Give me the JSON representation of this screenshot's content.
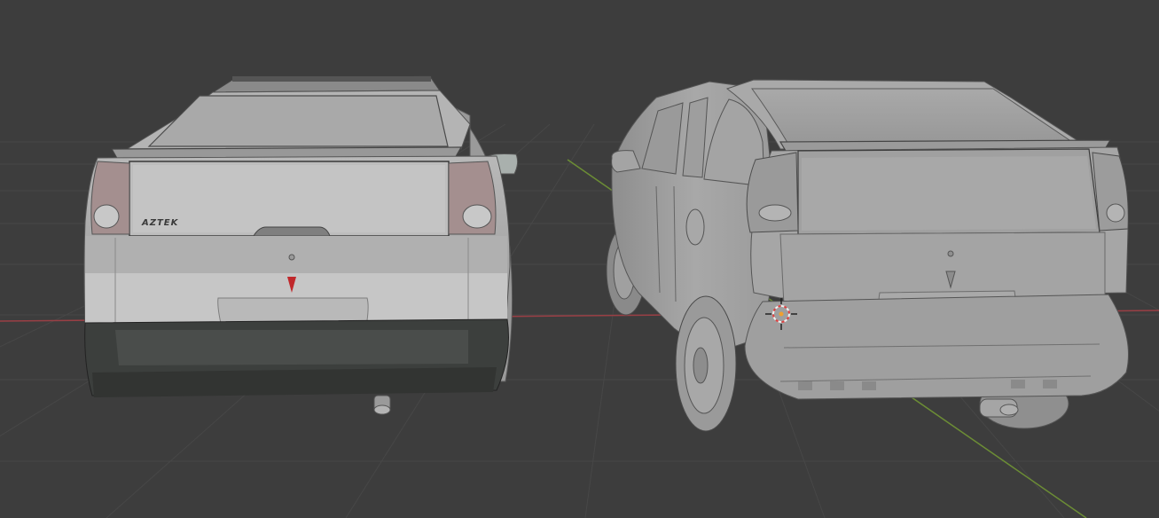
{
  "viewport": {
    "background": "#3d3d3d",
    "grid_color": "#474747",
    "x_axis_color": "#9a3f45",
    "y_axis_color": "#6c8d35"
  },
  "left_model": {
    "badge_text": "AZTEK",
    "body_color": "#a7a7a7",
    "lower_color": "#3c3f3d",
    "taillight_color": "#a48f8f",
    "emblem_color": "#c0282b"
  },
  "right_model": {
    "body_color": "#a2a2a2"
  },
  "cursor": {
    "icon": "3d-cursor-icon",
    "ring_color": "#e04040",
    "fill_color": "#f0f0f0"
  }
}
